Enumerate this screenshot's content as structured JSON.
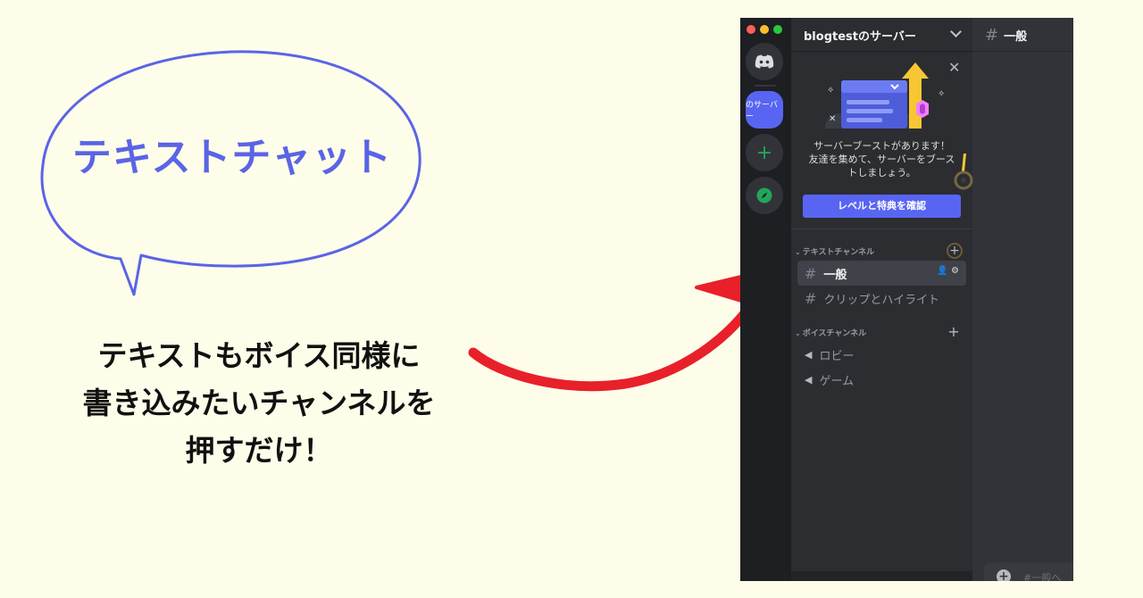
{
  "annotation": {
    "bubble_text": "テキストチャット",
    "caption_lines": [
      "テキストもボイス同様に",
      "書き込みたいチャンネルを",
      "押すだけ！"
    ],
    "bubble_color": "#5a64e6",
    "arrow_color": "#e8202a",
    "background_color": "#fefde9"
  },
  "discord": {
    "server_name": "blogtestのサーバー",
    "active_server_label": "のサーバー",
    "add_server_symbol": "+",
    "accent_color": "#5865f2",
    "boost": {
      "close_symbol": "✕",
      "lines": [
        "サーバーブーストがあります！",
        "友達を集めて、サーバーをブース",
        "トしましょう。"
      ],
      "button_label": "レベルと特典を確認"
    },
    "categories": [
      {
        "label": "テキストチャンネル",
        "add_symbol": "+",
        "channels": [
          {
            "name": "一般",
            "icon": "hash-icon",
            "active": true
          },
          {
            "name": "クリップとハイライト",
            "icon": "hash-icon",
            "active": false
          }
        ]
      },
      {
        "label": "ボイスチャンネル",
        "add_symbol": "+",
        "channels": [
          {
            "name": "ロビー",
            "icon": "speaker-icon",
            "active": false
          },
          {
            "name": "ゲーム",
            "icon": "speaker-icon",
            "active": false
          }
        ]
      }
    ],
    "current_channel": "一般",
    "hash_symbol": "#",
    "speaker_symbol": "◀",
    "message_placeholder": "#一般へ",
    "message_plus": "+"
  }
}
